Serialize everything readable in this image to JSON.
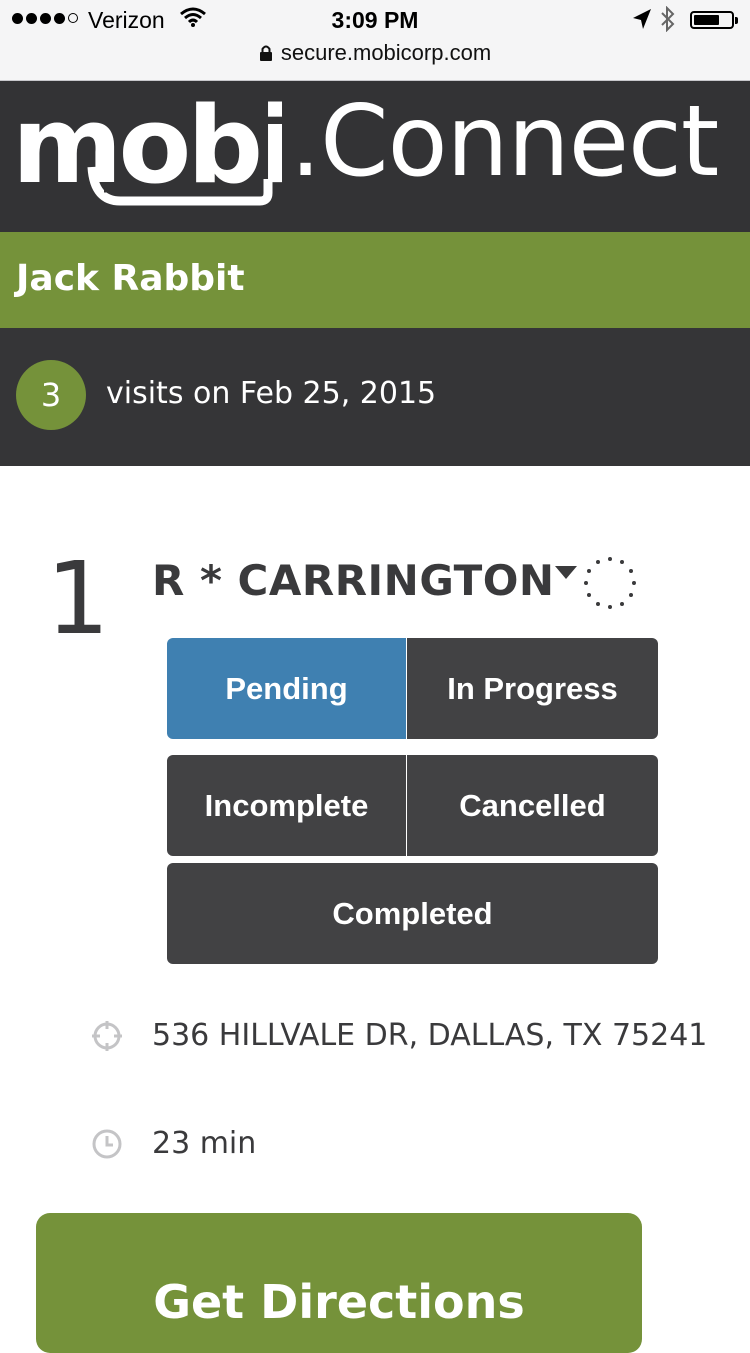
{
  "status_bar": {
    "carrier": "Verizon",
    "time": "3:09 PM",
    "url": "secure.mobicorp.com"
  },
  "header": {
    "logo_mobi": "mobi",
    "logo_connect": ".Connect"
  },
  "user": {
    "name": "Jack Rabbit"
  },
  "visits": {
    "count": "3",
    "label": "visits on Feb 25, 2015"
  },
  "visit": {
    "number": "1",
    "name": "R * CARRINGTON",
    "statuses": {
      "pending": "Pending",
      "in_progress": "In Progress",
      "incomplete": "Incomplete",
      "cancelled": "Cancelled",
      "completed": "Completed"
    },
    "selected_status": "Pending",
    "address": "536 HILLVALE DR, DALLAS, TX 75241",
    "duration": "23 min",
    "directions_label": "Get Directions"
  },
  "colors": {
    "brand_green": "#75923a",
    "header_dark": "#333335",
    "active_blue": "#3f80b1",
    "button_dark": "#424244"
  }
}
